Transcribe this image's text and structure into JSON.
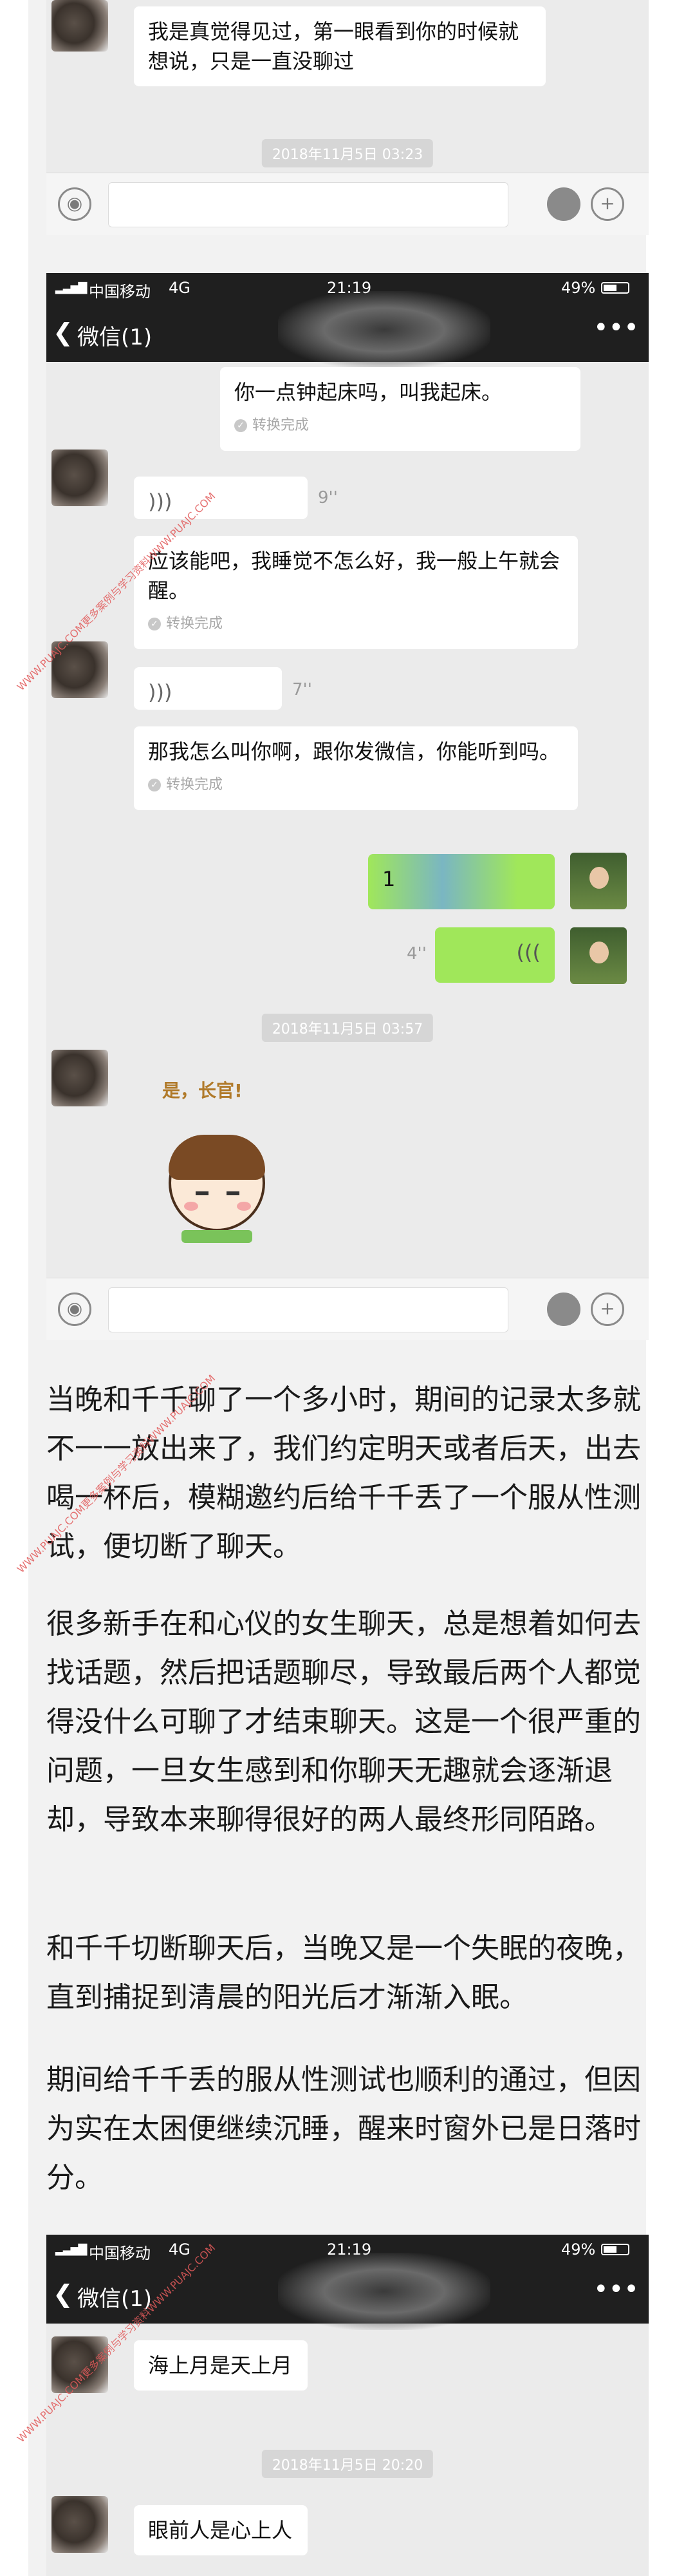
{
  "colors": {
    "accent_green": "#a0e75a",
    "chat_bg": "#ebebeb",
    "bar_dark": "#1f1f1f",
    "watermark": "#e25a5a"
  },
  "top_chat": {
    "bubble_text": "我是真觉得见过，第一眼看到你的时候就想说，只是一直没聊过",
    "timestamp": "2018年11月5日 03:23"
  },
  "status_bar": {
    "carrier": "中国移动",
    "network": "4G",
    "time": "21:19",
    "battery": "49%"
  },
  "nav": {
    "back_label": "微信(1)",
    "more_icon": "more-icon"
  },
  "chat2": {
    "m1": {
      "text": "你一点钟起床吗，叫我起床。",
      "convert": "转换完成"
    },
    "v1": {
      "duration": "9''"
    },
    "m2": {
      "text": "应该能吧，我睡觉不怎么好，我一般上午就会醒。",
      "convert": "转换完成"
    },
    "v2": {
      "duration": "7''"
    },
    "m3": {
      "text": "那我怎么叫你啊，跟你发微信，你能听到吗。",
      "convert": "转换完成"
    },
    "green1_text": "1",
    "v3": {
      "duration": "4''"
    },
    "timestamp": "2018年11月5日 03:57",
    "sticker_text": "是，长官!"
  },
  "paragraphs": [
    "当晚和千千聊了一个多小时，期间的记录太多就不一一放出来了，我们约定明天或者后天，出去喝一杯后，模糊邀约后给千千丢了一个服从性测试，便切断了聊天。",
    "很多新手在和心仪的女生聊天，总是想着如何去找话题，然后把话题聊尽，导致最后两个人都觉得没什么可聊了才结束聊天。这是一个很严重的问题，一旦女生感到和你聊天无趣就会逐渐退却，导致本来聊得很好的两人最终形同陌路。",
    "和千千切断聊天后，当晚又是一个失眠的夜晚，直到捕捉到清晨的阳光后才渐渐入眠。",
    "期间给千千丢的服从性测试也顺利的通过，但因为实在太困便继续沉睡，醒来时窗外已是日落时分。"
  ],
  "chat3": {
    "m1": "海上月是天上月",
    "timestamp": "2018年11月5日 20:20",
    "m2": "眼前人是心上人"
  },
  "watermark_text": "WWW.PUAJC.COM更多案例与学习资料WWW.PUAJC.COM"
}
